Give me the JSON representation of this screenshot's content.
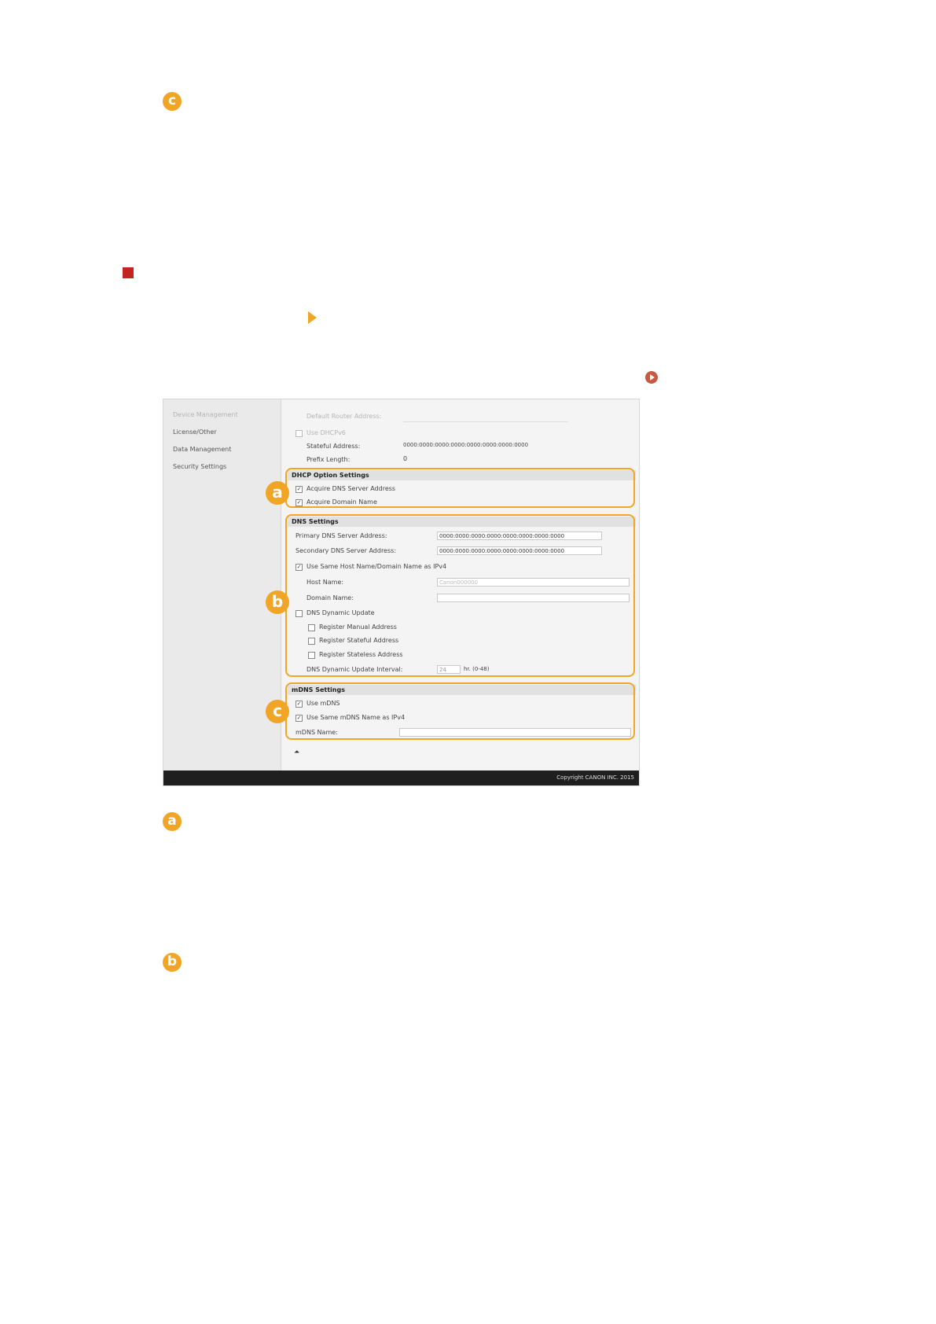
{
  "markers": {
    "a": "a",
    "b": "b",
    "c": "c"
  },
  "screenshot": {
    "sidebar": {
      "items": [
        "Device Management",
        "License/Other",
        "Data Management",
        "Security Settings"
      ]
    },
    "top_section": {
      "default_router_label": "Default Router Address:",
      "use_dhcpv6_label": "Use DHCPv6",
      "stateful_address_label": "Stateful Address:",
      "stateful_address_value": "0000:0000:0000:0000:0000:0000:0000:0000",
      "prefix_length_label": "Prefix Length:",
      "prefix_length_value": "0"
    },
    "dhcp": {
      "header": "DHCP Option Settings",
      "acquire_dns_label": "Acquire DNS Server Address",
      "acquire_domain_label": "Acquire Domain Name"
    },
    "dns": {
      "header": "DNS Settings",
      "primary_label": "Primary DNS Server Address:",
      "primary_value": "0000:0000:0000:0000:0000:0000:0000:0000",
      "secondary_label": "Secondary DNS Server Address:",
      "secondary_value": "0000:0000:0000:0000:0000:0000:0000:0000",
      "use_same_host_label": "Use Same Host Name/Domain Name as IPv4",
      "host_name_label": "Host Name:",
      "host_name_value": "Canon000000",
      "domain_name_label": "Domain Name:",
      "domain_name_value": "",
      "dynamic_update_label": "DNS Dynamic Update",
      "register_manual_label": "Register Manual Address",
      "register_stateful_label": "Register Stateful Address",
      "register_stateless_label": "Register Stateless Address",
      "interval_label": "DNS Dynamic Update Interval:",
      "interval_value": "24",
      "interval_unit": "hr. (0-48)"
    },
    "mdns": {
      "header": "mDNS Settings",
      "use_mdns_label": "Use mDNS",
      "use_same_mdns_label": "Use Same mDNS Name as IPv4",
      "mdns_name_label": "mDNS Name:",
      "mdns_name_value": ""
    },
    "checkmark": "✓",
    "up_icon": "⏶",
    "copyright": "Copyright CANON INC. 2015"
  }
}
